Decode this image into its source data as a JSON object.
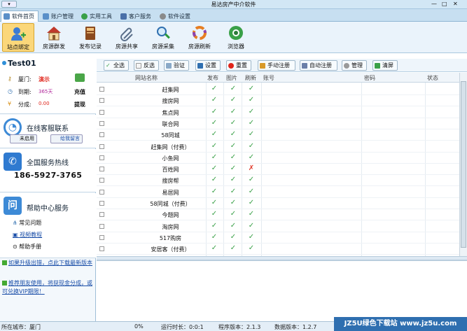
{
  "title": "易达房产中介软件",
  "tabs": [
    {
      "label": "软件首页",
      "active": true
    },
    {
      "label": "账户管理"
    },
    {
      "label": "实用工具"
    },
    {
      "label": "客户服务"
    },
    {
      "label": "软件设置"
    }
  ],
  "ribbon": [
    {
      "label": "站点绑定",
      "icon": "user-add-icon",
      "active": true
    },
    {
      "label": "房源群发",
      "icon": "house-icon"
    },
    {
      "label": "发布记录",
      "icon": "book-icon"
    },
    {
      "label": "房源共享",
      "icon": "paperclip-icon"
    },
    {
      "label": "房源采集",
      "icon": "magnifier-icon"
    },
    {
      "label": "房源刷新",
      "icon": "refresh-ring-icon"
    },
    {
      "label": "浏览器",
      "icon": "browser-icon"
    }
  ],
  "user": {
    "name": "Test01",
    "city_label": "厦门:",
    "city_value": "演示",
    "expire_label": "到期:",
    "expire_value": "365天",
    "points_label": "分成:",
    "points_value": "0.00",
    "recharge": "充值",
    "withdraw": "提现"
  },
  "support": {
    "title": "在线客服联系",
    "btn_unused": "未启用",
    "btn_message": "给我留言"
  },
  "hotline": {
    "title": "全国服务热线",
    "number": "186-5927-3765"
  },
  "help": {
    "title": "帮助中心服务",
    "faq": "常见问题",
    "video": "视频教程",
    "manual": "帮助手册"
  },
  "promo": {
    "upgrade": "如果升级出错，点此下载最新版本",
    "invite": "推荐朋友使用，将获现金分成，或可兑换VIP期限！"
  },
  "toolbar": [
    "全选",
    "反选",
    "验证",
    "设置",
    "重置",
    "手动注册",
    "自动注册",
    "管理",
    "清屏"
  ],
  "grid": {
    "headers": {
      "site": "网站名称",
      "publish": "发布",
      "image": "图片",
      "refresh": "刷新",
      "account": "账号",
      "password": "密码",
      "status": "状态"
    },
    "rows": [
      {
        "site": "赶集网",
        "p": "✓",
        "i": "✓",
        "r": "✓"
      },
      {
        "site": "搜房网",
        "p": "✓",
        "i": "✓",
        "r": "✓"
      },
      {
        "site": "焦点网",
        "p": "✓",
        "i": "✓",
        "r": "✓"
      },
      {
        "site": "联合网",
        "p": "✓",
        "i": "✓",
        "r": "✓"
      },
      {
        "site": "58同城",
        "p": "✓",
        "i": "✓",
        "r": "✓"
      },
      {
        "site": "赶集网（付费）",
        "p": "✓",
        "i": "✓",
        "r": "✓"
      },
      {
        "site": "小鱼网",
        "p": "✓",
        "i": "✓",
        "r": "✓"
      },
      {
        "site": "百姓网",
        "p": "✓",
        "i": "✓",
        "r": "✗"
      },
      {
        "site": "搜房帮",
        "p": "✓",
        "i": "✓",
        "r": "✓"
      },
      {
        "site": "易居网",
        "p": "✓",
        "i": "✓",
        "r": "✓"
      },
      {
        "site": "58同城（付费）",
        "p": "✓",
        "i": "✓",
        "r": "✓"
      },
      {
        "site": "今题网",
        "p": "✓",
        "i": "✓",
        "r": "✓"
      },
      {
        "site": "淘房网",
        "p": "✓",
        "i": "✓",
        "r": "✓"
      },
      {
        "site": "517购房",
        "p": "✓",
        "i": "✓",
        "r": "✓"
      },
      {
        "site": "安居客（付费）",
        "p": "✓",
        "i": "✓",
        "r": "✓"
      }
    ]
  },
  "status": {
    "city": "所在城市：厦门",
    "progress": "0%",
    "runtime": "运行时长：0:0:1",
    "program_version": "程序版本：2.1.3",
    "data_version": "数据版本：1.2.7"
  },
  "watermark": "JZ5U绿色下载站 www.jz5u.com",
  "colors": {
    "check": "#3aa048",
    "cross": "#e03a2b",
    "accent": "#3d8ad6",
    "active_ribbon": "#fbd77a"
  }
}
